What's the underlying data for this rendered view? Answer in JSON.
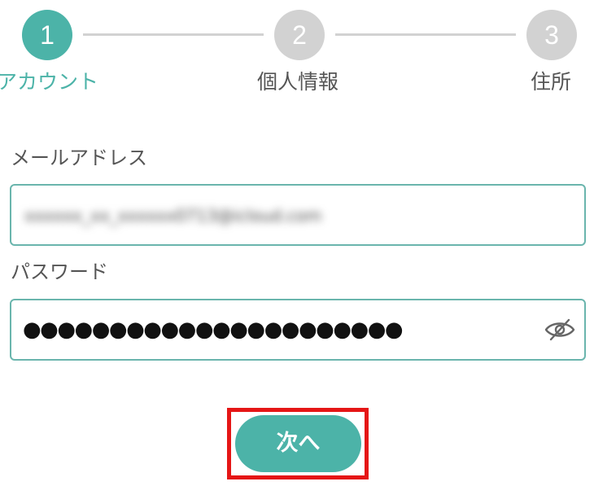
{
  "stepper": {
    "steps": [
      {
        "number": "1",
        "label": "アカウント",
        "state": "active"
      },
      {
        "number": "2",
        "label": "個人情報",
        "state": "inactive"
      },
      {
        "number": "3",
        "label": "住所",
        "state": "inactive"
      }
    ]
  },
  "form": {
    "email": {
      "label": "メールアドレス",
      "value": "xxxxxx_xx_xxxxxx0713@icloud.com"
    },
    "password": {
      "label": "パスワード",
      "value": "●●●●●●●●●●●●●●●●●●●●●●"
    }
  },
  "next_button": {
    "label": "次へ"
  },
  "colors": {
    "accent": "#4cb3a8",
    "inactive": "#d2d2d2",
    "field_border": "#6ab5ad",
    "highlight": "#e51616"
  },
  "icons": {
    "password_toggle": "eye-slash-icon"
  }
}
